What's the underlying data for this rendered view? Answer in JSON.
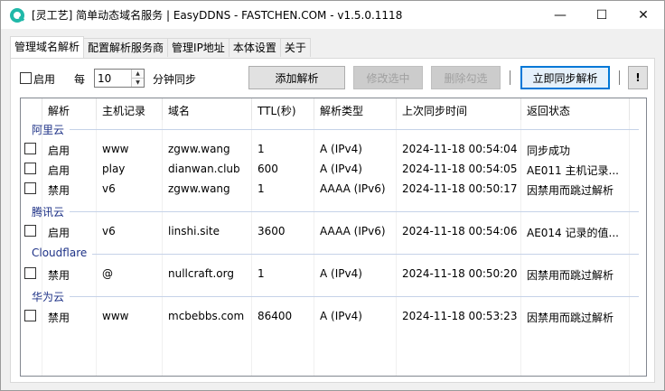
{
  "window": {
    "title": "[灵工艺] 简单动态域名服务 | EasyDDNS - FASTCHEN.COM - v1.5.0.1118",
    "minimize": "—",
    "maximize": "☐",
    "close": "✕"
  },
  "tabs": [
    "管理域名解析",
    "配置解析服务商",
    "管理IP地址",
    "本体设置",
    "关于"
  ],
  "toolbar": {
    "enable_label": "启用",
    "every_label": "每",
    "interval_value": "10",
    "interval_suffix": "分钟同步",
    "add_label": "添加解析",
    "edit_label": "修改选中",
    "delete_label": "删除勾选",
    "sync_label": "立即同步解析",
    "separator": "|",
    "alert_label": "!"
  },
  "table": {
    "headers": [
      "解析",
      "主机记录",
      "域名",
      "TTL(秒)",
      "解析类型",
      "上次同步时间",
      "返回状态"
    ],
    "groups": [
      {
        "name": "阿里云",
        "rows": [
          {
            "enabled": "启用",
            "host": "www",
            "domain": "zgww.wang",
            "ttl": "1",
            "type": "A (IPv4)",
            "last_sync": "2024-11-18 00:54:04",
            "status": "同步成功"
          },
          {
            "enabled": "启用",
            "host": "play",
            "domain": "dianwan.club",
            "ttl": "600",
            "type": "A (IPv4)",
            "last_sync": "2024-11-18 00:54:05",
            "status": "AE011 主机记录..."
          },
          {
            "enabled": "禁用",
            "host": "v6",
            "domain": "zgww.wang",
            "ttl": "1",
            "type": "AAAA (IPv6)",
            "last_sync": "2024-11-18 00:50:17",
            "status": "因禁用而跳过解析"
          }
        ]
      },
      {
        "name": "腾讯云",
        "rows": [
          {
            "enabled": "启用",
            "host": "v6",
            "domain": "linshi.site",
            "ttl": "3600",
            "type": "AAAA (IPv6)",
            "last_sync": "2024-11-18 00:54:06",
            "status": "AE014 记录的值..."
          }
        ]
      },
      {
        "name": "Cloudflare",
        "rows": [
          {
            "enabled": "禁用",
            "host": "@",
            "domain": "nullcraft.org",
            "ttl": "1",
            "type": "A (IPv4)",
            "last_sync": "2024-11-18 00:50:20",
            "status": "因禁用而跳过解析"
          }
        ]
      },
      {
        "name": "华为云",
        "rows": [
          {
            "enabled": "禁用",
            "host": "www",
            "domain": "mcbebbs.com",
            "ttl": "86400",
            "type": "A (IPv4)",
            "last_sync": "2024-11-18 00:53:23",
            "status": "因禁用而跳过解析"
          }
        ]
      }
    ]
  },
  "colors": {
    "accent": "#0078d7",
    "group_title": "#1e3287",
    "app_icon": "#20b8a8"
  }
}
